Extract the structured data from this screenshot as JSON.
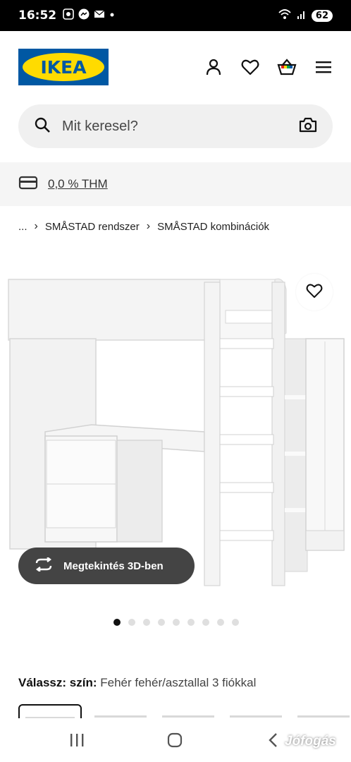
{
  "status_bar": {
    "time": "16:52",
    "battery": "62",
    "icons": [
      "screen-record-icon",
      "messenger-icon",
      "mail-icon",
      "dot-icon",
      "wifi-icon",
      "signal-icon"
    ]
  },
  "header": {
    "logo_text": "IKEA",
    "icons": [
      "user-icon",
      "heart-icon",
      "basket-icon",
      "menu-icon"
    ]
  },
  "search": {
    "placeholder": "Mit keresel?",
    "icons": [
      "search-icon",
      "camera-icon"
    ]
  },
  "financing": {
    "label": "0,0 % THM",
    "icon": "card-icon"
  },
  "breadcrumb": {
    "items": [
      "...",
      "SMÅSTAD rendszer",
      "SMÅSTAD kombinációk"
    ]
  },
  "product": {
    "view_3d_label": "Megtekintés 3D-ben",
    "carousel_count": 9,
    "carousel_active_index": 0
  },
  "color": {
    "label": "Válassz: szín:",
    "value": "Fehér fehér/asztallal 3 fiókkal"
  },
  "navbar": {
    "icons": [
      "recent-apps-icon",
      "home-icon",
      "back-icon"
    ]
  },
  "watermark": "Jófogás",
  "colors": {
    "ikea_blue": "#0058a3",
    "ikea_yellow": "#ffdb00",
    "button_dark": "#444444"
  }
}
